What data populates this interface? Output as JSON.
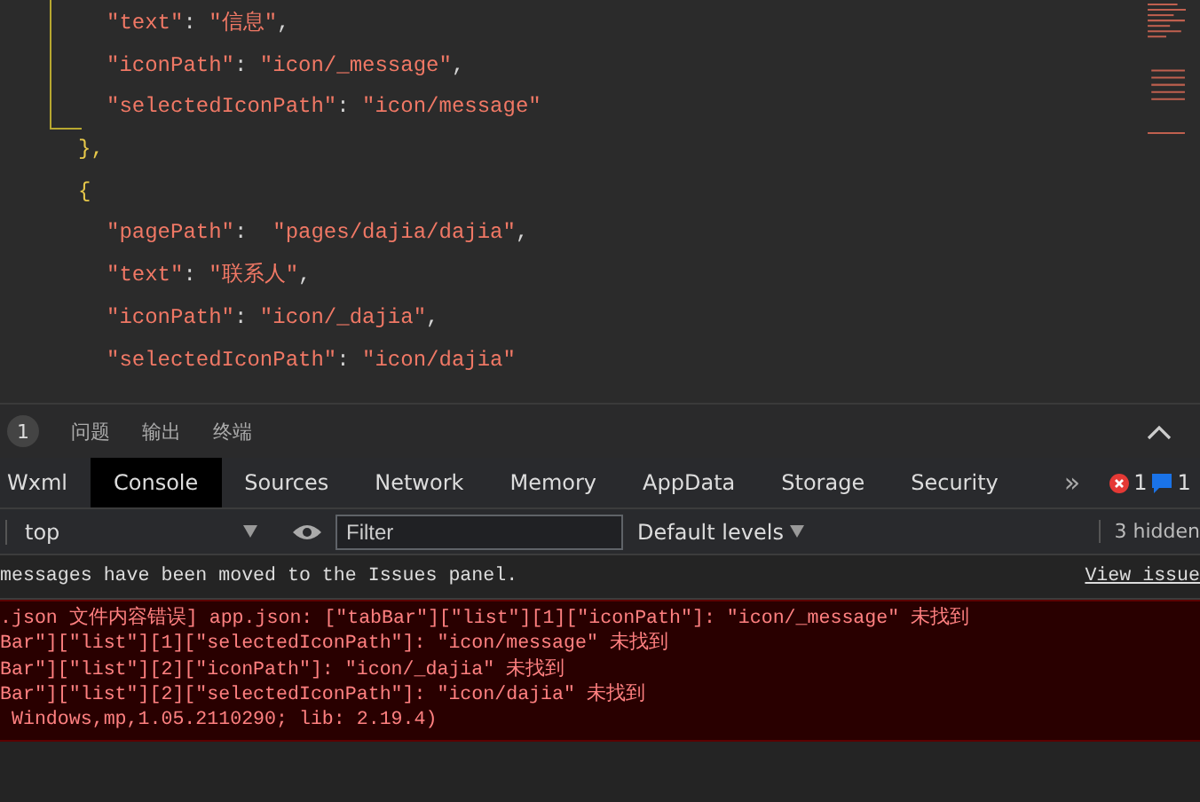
{
  "editor": {
    "lines": [
      {
        "kind": "pair",
        "key": "\"text\"",
        "sep": ": ",
        "value": "\"信息\"",
        "end": ","
      },
      {
        "kind": "pair",
        "key": "\"iconPath\"",
        "sep": ": ",
        "value": "\"icon/_message\"",
        "end": ","
      },
      {
        "kind": "pair",
        "key": "\"selectedIconPath\"",
        "sep": ": ",
        "value": "\"icon/message\""
      },
      {
        "kind": "brace",
        "text": "},"
      },
      {
        "kind": "brace",
        "text": "{"
      },
      {
        "kind": "pair",
        "key": "\"pagePath\"",
        "sep": ":  ",
        "value": "\"pages/dajia/dajia\"",
        "end": ","
      },
      {
        "kind": "pair",
        "key": "\"text\"",
        "sep": ": ",
        "value": "\"联系人\"",
        "end": ","
      },
      {
        "kind": "pair",
        "key": "\"iconPath\"",
        "sep": ": ",
        "value": "\"icon/_dajia\"",
        "end": ","
      },
      {
        "kind": "pair",
        "key": "\"selectedIconPath\"",
        "sep": ": ",
        "value": "\"icon/dajia\""
      }
    ]
  },
  "panel_bar": {
    "badge": "1",
    "tabs": [
      {
        "label": "问题",
        "selected": false
      },
      {
        "label": "输出",
        "selected": false
      },
      {
        "label": "终端",
        "selected": false
      }
    ]
  },
  "devtools_tabs": [
    {
      "label": "Wxml",
      "selected": false
    },
    {
      "label": "Console",
      "selected": true
    },
    {
      "label": "Sources",
      "selected": false
    },
    {
      "label": "Network",
      "selected": false
    },
    {
      "label": "Memory",
      "selected": false
    },
    {
      "label": "AppData",
      "selected": false
    },
    {
      "label": "Storage",
      "selected": false
    },
    {
      "label": "Security",
      "selected": false
    }
  ],
  "more_tabs": "»",
  "counts": {
    "errors": "1",
    "messages": "1"
  },
  "console_toolbar": {
    "context": "top",
    "filter_placeholder": "Filter",
    "levels": "Default levels",
    "hidden": "3 hidden"
  },
  "console": {
    "notice": "messages have been moved to the Issues panel.",
    "notice_link": "View issue",
    "error_lines": [
      ".json 文件内容错误] app.json: [\"tabBar\"][\"list\"][1][\"iconPath\"]: \"icon/_message\" 未找到",
      "Bar\"][\"list\"][1][\"selectedIconPath\"]: \"icon/message\" 未找到",
      "Bar\"][\"list\"][2][\"iconPath\"]: \"icon/_dajia\" 未找到",
      "Bar\"][\"list\"][2][\"selectedIconPath\"]: \"icon/dajia\" 未找到",
      " Windows,mp,1.05.2110290; lib: 2.19.4)"
    ]
  }
}
